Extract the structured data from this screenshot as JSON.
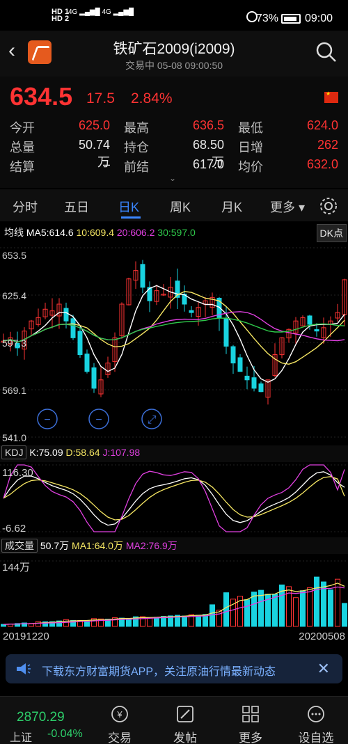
{
  "status_bar": {
    "hd1": "HD 1",
    "hd2": "HD 2",
    "net1": "4G",
    "net2": "4G",
    "battery": "73%",
    "time": "09:00"
  },
  "header": {
    "title": "铁矿石2009(i2009)",
    "subtitle": "交易中  05-08 09:00:50"
  },
  "quote": {
    "price": "634.5",
    "change": "17.5",
    "change_pct": "2.84%",
    "rows": [
      [
        {
          "label": "今开",
          "value": "625.0",
          "color": "red"
        },
        {
          "label": "最高",
          "value": "636.5",
          "color": "red"
        },
        {
          "label": "最低",
          "value": "624.0",
          "color": "red"
        }
      ],
      [
        {
          "label": "总量",
          "value": "50.74万",
          "color": "white"
        },
        {
          "label": "持仓",
          "value": "68.50万",
          "color": "white"
        },
        {
          "label": "日增",
          "value": "262",
          "color": "red"
        }
      ],
      [
        {
          "label": "结算",
          "value": "–",
          "color": "white"
        },
        {
          "label": "前结",
          "value": "617.0",
          "color": "white"
        },
        {
          "label": "均价",
          "value": "632.0",
          "color": "red"
        }
      ]
    ]
  },
  "tabs": {
    "items": [
      "分时",
      "五日",
      "日K",
      "周K",
      "月K",
      "更多"
    ],
    "active": "日K",
    "more_arrow": "▾"
  },
  "ma_legend": {
    "label": "均线",
    "ma5": "MA5:614.6",
    "ma10": "10:609.4",
    "ma20": "20:606.2",
    "ma30": "30:597.0",
    "dk": "DK点"
  },
  "kline": {
    "y_ticks": [
      "653.5",
      "625.4",
      "597.3",
      "569.1",
      "541.0"
    ]
  },
  "kdj": {
    "label": "KDJ",
    "k": "K:75.09",
    "d": "D:58.64",
    "j": "J:107.98",
    "y_top": "116.30",
    "y_bottom": "-6.62"
  },
  "volume": {
    "label": "成交量",
    "vol": "50.7万",
    "ma1": "MA1:64.0万",
    "ma2": "MA2:76.9万",
    "y_top": "144万",
    "date_start": "20191220",
    "date_end": "20200508"
  },
  "banner": {
    "text": "下载东方财富期货APP，关注原油行情最新动态",
    "close": "✕"
  },
  "bottom_bar": {
    "index_value": "2870.29",
    "index_name": "上证",
    "index_pct": "-0.04%",
    "items": [
      {
        "label": "交易",
        "icon": "yuan-icon"
      },
      {
        "label": "发帖",
        "icon": "edit-icon"
      },
      {
        "label": "更多",
        "icon": "grid-icon"
      },
      {
        "label": "设自选",
        "icon": "more-icon"
      }
    ]
  },
  "colors": {
    "up": "#ff3333",
    "down": "#19d3e0",
    "ma5": "#ffffff",
    "ma10": "#f5e663",
    "ma20": "#e040e0",
    "ma30": "#2ec94a",
    "accent": "#3a86ff"
  }
}
